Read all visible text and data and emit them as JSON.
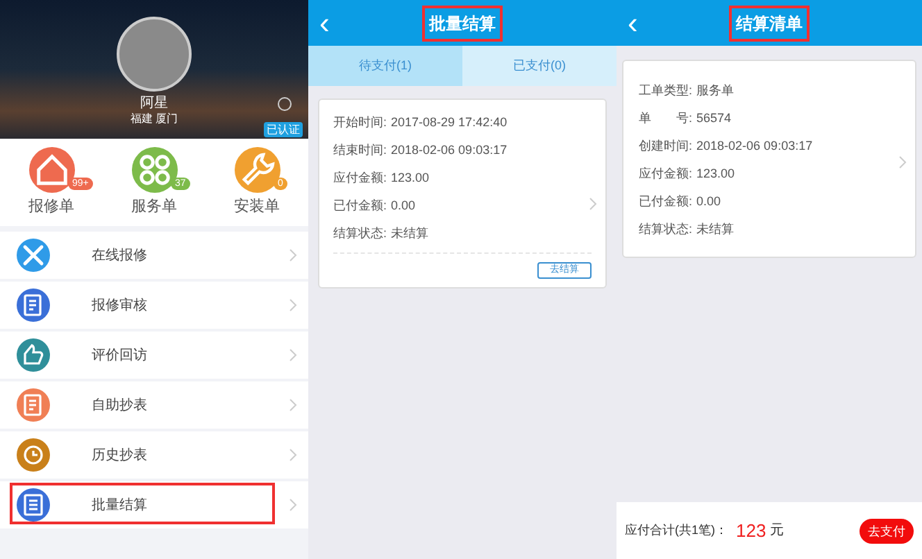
{
  "profile": {
    "name": "阿星",
    "location": "福建 厦门",
    "badge": "已认证"
  },
  "shortcuts": [
    {
      "label": "报修单",
      "count": "99+",
      "color": "#ee6a4f"
    },
    {
      "label": "服务单",
      "count": "37",
      "color": "#7dbb4a"
    },
    {
      "label": "安装单",
      "count": "0",
      "color": "#f0a030"
    }
  ],
  "menu": [
    {
      "label": "在线报修",
      "color": "#2f9be8",
      "highlighted": false
    },
    {
      "label": "报修审核",
      "color": "#3a6fd8",
      "highlighted": false
    },
    {
      "label": "评价回访",
      "color": "#2f8f9a",
      "highlighted": false
    },
    {
      "label": "自助抄表",
      "color": "#f07f55",
      "highlighted": false
    },
    {
      "label": "历史抄表",
      "color": "#c9801a",
      "highlighted": false
    },
    {
      "label": "批量结算",
      "color": "#3a6fd8",
      "highlighted": true
    }
  ],
  "batch": {
    "title": "批量结算",
    "title_highlighted": true,
    "back": "‹",
    "tabs": [
      {
        "label": "待支付(1)",
        "selected": true
      },
      {
        "label": "已支付(0)",
        "selected": false
      }
    ],
    "card": {
      "fields": [
        {
          "label": "开始时间:",
          "value": "2017-08-29 17:42:40"
        },
        {
          "label": "结束时间:",
          "value": "2018-02-06 09:03:17"
        },
        {
          "label": "应付金额:",
          "value": "123.00"
        },
        {
          "label": "已付金额:",
          "value": "0.00"
        },
        {
          "label": "结算状态:",
          "value": "未结算"
        }
      ],
      "button": "去结算"
    }
  },
  "bill": {
    "title": "结算清单",
    "title_highlighted": true,
    "back": "‹",
    "fields": [
      {
        "label": "工单类型:",
        "value": "服务单"
      },
      {
        "label": "单　　号:",
        "value": "56574"
      },
      {
        "label": "创建时间:",
        "value": "2018-02-06 09:03:17"
      },
      {
        "label": "应付金额:",
        "value": "123.00"
      },
      {
        "label": "已付金额:",
        "value": "0.00"
      },
      {
        "label": "结算状态:",
        "value": "未结算"
      }
    ],
    "total_label": "应付合计(共1笔)：",
    "total_amount": "123",
    "currency": "元",
    "pay_button": "去支付"
  }
}
